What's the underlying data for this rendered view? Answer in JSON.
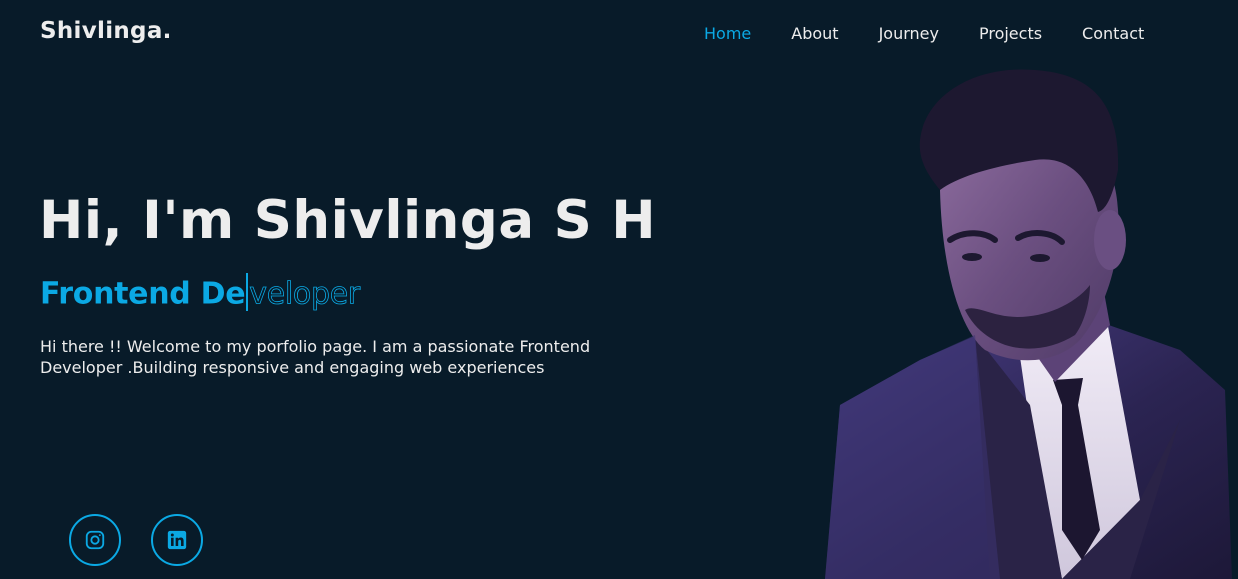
{
  "header": {
    "logo": "Shivlinga.",
    "nav": [
      {
        "label": "Home",
        "active": true
      },
      {
        "label": "About",
        "active": false
      },
      {
        "label": "Journey",
        "active": false
      },
      {
        "label": "Projects",
        "active": false
      },
      {
        "label": "Contact",
        "active": false
      }
    ]
  },
  "hero": {
    "title": "Hi, I'm Shivlinga S H",
    "subtitle_typed": "Frontend De",
    "subtitle_rest": "veloper",
    "intro": "Hi there !! Welcome to my porfolio page. I am a passionate Frontend Developer .Building responsive and engaging web experiences"
  },
  "social": [
    {
      "icon": "instagram-icon"
    },
    {
      "icon": "linkedin-icon"
    }
  ],
  "colors": {
    "background": "#081b29",
    "accent": "#0ba9e4",
    "text": "#ededed"
  }
}
